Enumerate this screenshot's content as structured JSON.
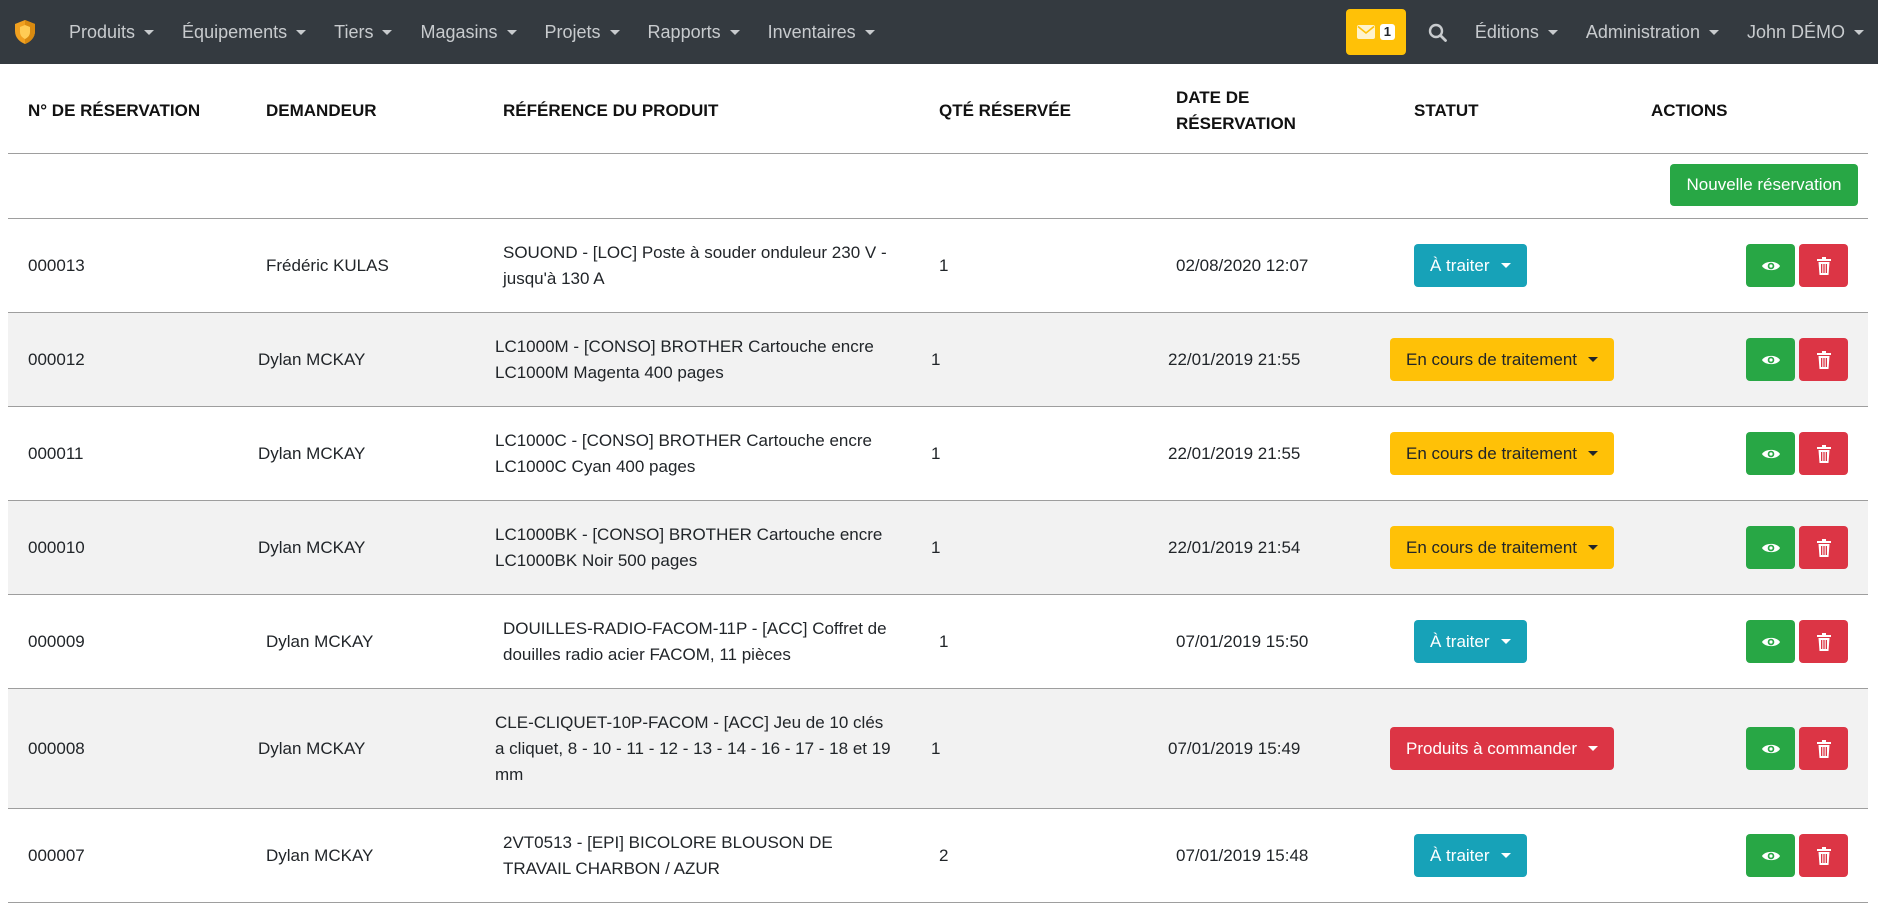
{
  "nav": {
    "menu": [
      {
        "label": "Produits"
      },
      {
        "label": "Équipements"
      },
      {
        "label": "Tiers"
      },
      {
        "label": "Magasins"
      },
      {
        "label": "Projets"
      },
      {
        "label": "Rapports"
      },
      {
        "label": "Inventaires"
      }
    ],
    "messages_count": "1",
    "editions": "Éditions",
    "administration": "Administration",
    "user": "John DÉMO"
  },
  "colors": {
    "navbar": "#343a40",
    "success": "#28a745",
    "info": "#17a2b8",
    "warning": "#ffc107",
    "danger": "#dc3545"
  },
  "table": {
    "headers": {
      "num": "N° de réservation",
      "demandeur": "Demandeur",
      "ref": "Référence du produit",
      "qte": "Qté réservée",
      "date": "Date de réservation",
      "statut": "Statut",
      "actions": "Actions"
    },
    "new_button": "Nouvelle réservation",
    "rows": [
      {
        "num": "000013",
        "demandeur": "Frédéric KULAS",
        "ref": "SOUOND - [LOC] Poste à souder onduleur 230 V - jusqu'à 130 A",
        "qte": "1",
        "date": "02/08/2020 12:07",
        "status": "À traiter",
        "status_type": "info"
      },
      {
        "num": "000012",
        "demandeur": "Dylan MCKAY",
        "ref": "LC1000M - [CONSO] BROTHER Cartouche encre LC1000M Magenta 400 pages",
        "qte": "1",
        "date": "22/01/2019 21:55",
        "status": "En cours de traitement",
        "status_type": "warning"
      },
      {
        "num": "000011",
        "demandeur": "Dylan MCKAY",
        "ref": "LC1000C - [CONSO] BROTHER Cartouche encre LC1000C Cyan 400 pages",
        "qte": "1",
        "date": "22/01/2019 21:55",
        "status": "En cours de traitement",
        "status_type": "warning"
      },
      {
        "num": "000010",
        "demandeur": "Dylan MCKAY",
        "ref": "LC1000BK - [CONSO] BROTHER Cartouche encre LC1000BK Noir 500 pages",
        "qte": "1",
        "date": "22/01/2019 21:54",
        "status": "En cours de traitement",
        "status_type": "warning"
      },
      {
        "num": "000009",
        "demandeur": "Dylan MCKAY",
        "ref": "DOUILLES-RADIO-FACOM-11P - [ACC] Coffret de douilles radio acier FACOM, 11 pièces",
        "qte": "1",
        "date": "07/01/2019 15:50",
        "status": "À traiter",
        "status_type": "info"
      },
      {
        "num": "000008",
        "demandeur": "Dylan MCKAY",
        "ref": "CLE-CLIQUET-10P-FACOM - [ACC] Jeu de 10 clés a cliquet, 8 - 10 - 11 - 12 - 13 - 14 - 16 - 17 - 18 et 19 mm",
        "qte": "1",
        "date": "07/01/2019 15:49",
        "status": "Produits à commander",
        "status_type": "danger"
      },
      {
        "num": "000007",
        "demandeur": "Dylan MCKAY",
        "ref": "2VT0513 - [EPI] BICOLORE BLOUSON DE TRAVAIL CHARBON / AZUR",
        "qte": "2",
        "date": "07/01/2019 15:48",
        "status": "À traiter",
        "status_type": "info"
      }
    ]
  }
}
